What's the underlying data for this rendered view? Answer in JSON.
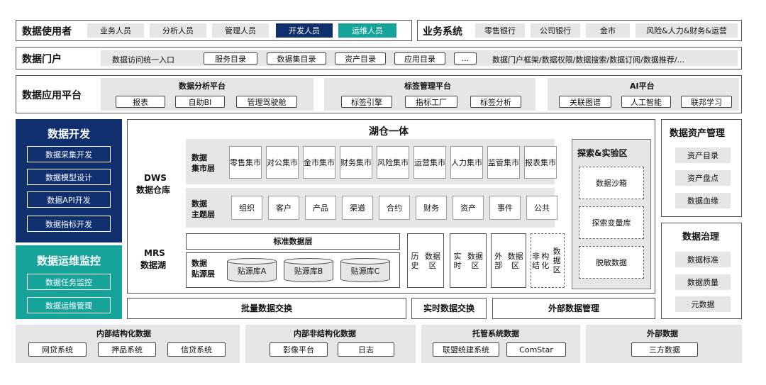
{
  "users": {
    "title": "数据使用者",
    "items": [
      {
        "label": "业务人员",
        "style": "tag"
      },
      {
        "label": "分析人员",
        "style": "tag"
      },
      {
        "label": "管理人员",
        "style": "tag"
      },
      {
        "label": "开发人员",
        "style": "navy"
      },
      {
        "label": "运维人员",
        "style": "teal"
      }
    ]
  },
  "business": {
    "title": "业务系统",
    "items": [
      "零售银行",
      "公司银行",
      "金市",
      "风险&人力&财务&运营"
    ]
  },
  "portal": {
    "title": "数据门户",
    "entry": "数据访问统一入口",
    "buttons": [
      "服务目录",
      "数据集目录",
      "资产目录",
      "应用目录",
      "..."
    ],
    "frame": "数据门户框架/数据权限/数据搜索/数据订阅/数据推荐/..."
  },
  "app_platform": {
    "title": "数据应用平台",
    "analysis": {
      "title": "数据分析平台",
      "items": [
        "报表",
        "自助BI",
        "管理驾驶舱"
      ]
    },
    "tag": {
      "title": "标签管理平台",
      "items": [
        "标签引擎",
        "指标工厂",
        "标签分析"
      ]
    },
    "ai": {
      "title": "AI平台",
      "items": [
        "关联图谱",
        "人工智能",
        "联邦学习"
      ]
    }
  },
  "dev": {
    "title": "数据开发",
    "items": [
      "数据采集开发",
      "数据模型设计",
      "数据API开发",
      "数据指标开发"
    ]
  },
  "ops": {
    "title": "数据运维监控",
    "items": [
      "数据任务监控",
      "数据运维管理"
    ]
  },
  "lakehouse": {
    "title": "湖仓一体",
    "dws_line1": "DWS",
    "dws_line2": "数据仓库",
    "mrs_line1": "MRS",
    "mrs_line2": "数据湖",
    "mart": {
      "label_line1": "数据",
      "label_line2": "集市层",
      "items": [
        [
          "零售",
          "集市"
        ],
        [
          "对公",
          "集市"
        ],
        [
          "金市",
          "集市"
        ],
        [
          "财务",
          "集市"
        ],
        [
          "风险",
          "集市"
        ],
        [
          "运营",
          "集市"
        ],
        [
          "人力",
          "集市"
        ],
        [
          "监管",
          "集市"
        ],
        [
          "报表",
          "集市"
        ]
      ]
    },
    "subject": {
      "label_line1": "数据",
      "label_line2": "主题层",
      "items": [
        "组织",
        "客户",
        "产品",
        "渠道",
        "合约",
        "财务",
        "资产",
        "事件",
        "公共"
      ]
    },
    "standard": "标准数据层",
    "source": {
      "label_line1": "数据",
      "label_line2": "贴源层",
      "items": [
        "贴源库A",
        "贴源库B",
        "贴源库C"
      ]
    },
    "zones": [
      [
        "历史",
        "数据区"
      ],
      [
        "实时",
        "数据区"
      ],
      [
        "外部",
        "数据区"
      ]
    ],
    "unstructured": [
      "非结",
      "构化",
      "数据区"
    ],
    "explore": {
      "title": "探索&实验区",
      "items": [
        "数据沙箱",
        "探索变量库",
        "脱敏数据"
      ]
    }
  },
  "asset": {
    "title": "数据资产管理",
    "items": [
      "资产目录",
      "资产盘点",
      "数据血缘"
    ]
  },
  "governance": {
    "title": "数据治理",
    "items": [
      "数据标准",
      "数据质量",
      "元数据"
    ]
  },
  "exchange": {
    "batch": "批量数据交换",
    "realtime": "实时数据交换",
    "external": "外部数据管理"
  },
  "sources": [
    {
      "title": "内部结构化数据",
      "items": [
        "网贷系统",
        "押品系统",
        "信贷系统"
      ]
    },
    {
      "title": "内部非结构化数据",
      "items": [
        "影像平台",
        "日志"
      ]
    },
    {
      "title": "托管系统数据",
      "items": [
        "联盟统建系统",
        "ComStar"
      ]
    },
    {
      "title": "外部数据",
      "items": [
        "三方数据"
      ]
    }
  ],
  "colors": {
    "navy": "#0f2f6f",
    "teal": "#15a39a",
    "gray": "#e6e6e6"
  }
}
